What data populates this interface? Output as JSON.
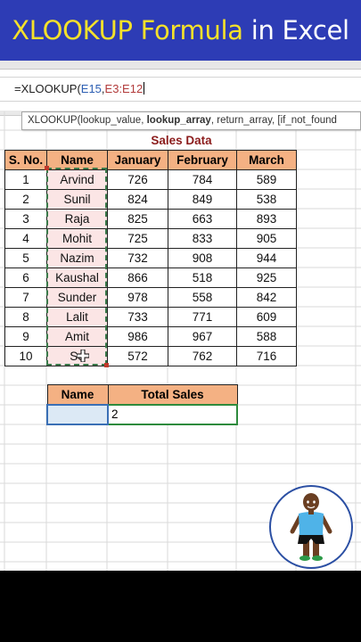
{
  "banner": {
    "title_part1": "XLOOKUP Formula",
    "title_part2": "in Excel"
  },
  "formula_bar": {
    "prefix": "=XLOOKUP(",
    "ref1": "E15",
    "sep": ",",
    "ref2": "E3:E12"
  },
  "tooltip": {
    "before": "XLOOKUP(lookup_value, ",
    "bold": "lookup_array",
    "after": ", return_array, [if_not_found"
  },
  "sheet": {
    "title": "Sales Data",
    "headers": [
      "S. No.",
      "Name",
      "January",
      "February",
      "March"
    ],
    "rows": [
      [
        "1",
        "Arvind",
        "726",
        "784",
        "589"
      ],
      [
        "2",
        "Sunil",
        "824",
        "849",
        "538"
      ],
      [
        "3",
        "Raja",
        "825",
        "663",
        "893"
      ],
      [
        "4",
        "Mohit",
        "725",
        "833",
        "905"
      ],
      [
        "5",
        "Nazim",
        "732",
        "908",
        "944"
      ],
      [
        "6",
        "Kaushal",
        "866",
        "518",
        "925"
      ],
      [
        "7",
        "Sunder",
        "978",
        "558",
        "842"
      ],
      [
        "8",
        "Lalit",
        "733",
        "771",
        "609"
      ],
      [
        "9",
        "Amit",
        "986",
        "967",
        "588"
      ],
      [
        "10",
        "So",
        "572",
        "762",
        "716"
      ]
    ]
  },
  "lookup": {
    "name_header": "Name",
    "total_header": "Total Sales",
    "name_value": "",
    "total_value": "2"
  },
  "colors": {
    "banner_bg": "#2d3cb5",
    "banner_accent": "#f5e12a",
    "header_fill": "#f4b183",
    "title_color": "#8b1c1c",
    "selection_green": "#2e8b3d",
    "selection_blue": "#3a6fb5"
  },
  "icons": {
    "cursor": "cell-select-cursor-icon",
    "avatar": "mascot-avatar-icon"
  }
}
